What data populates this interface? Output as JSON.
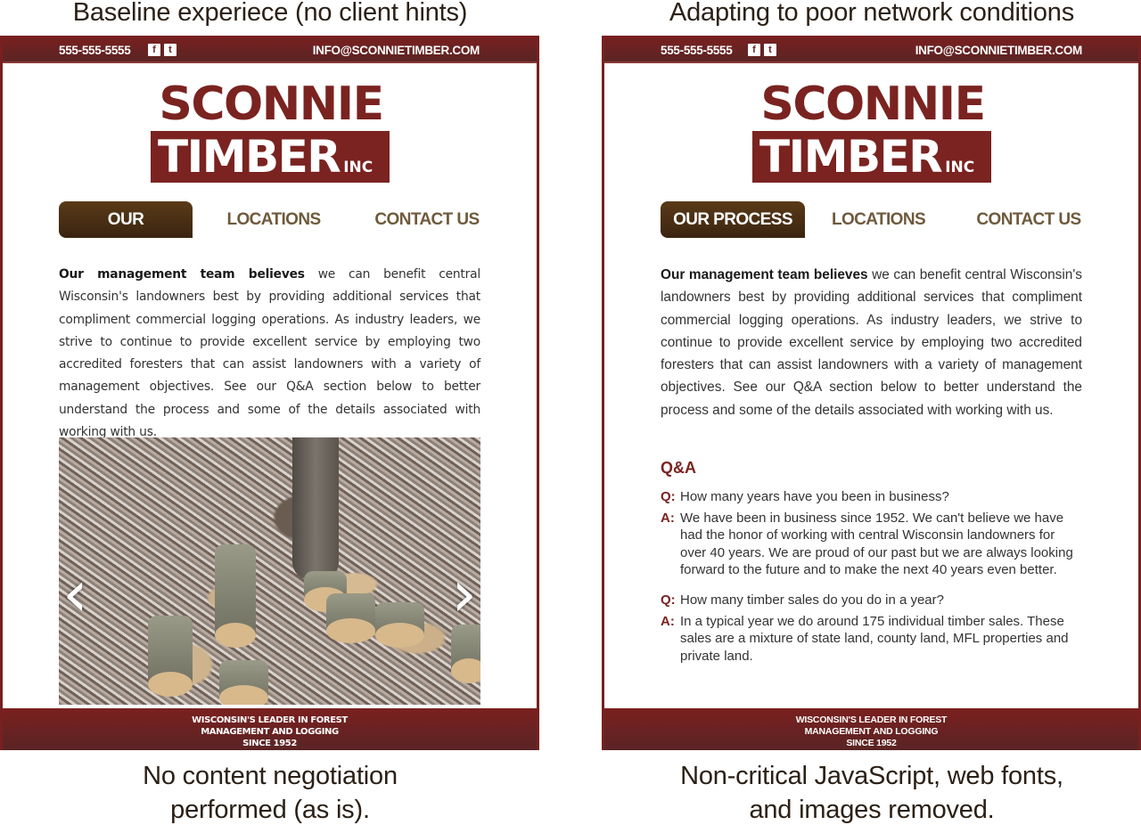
{
  "captions": {
    "left_top": "Baseline experiece (no client hints)",
    "right_top": "Adapting to poor network conditions",
    "left_bottom_line1": "No content negotiation",
    "left_bottom_line2": "performed (as is).",
    "right_bottom_line1": "Non-critical JavaScript, web fonts,",
    "right_bottom_line2": "and images removed."
  },
  "site": {
    "phone": "555-555-5555",
    "social": [
      {
        "icon": "facebook-icon",
        "glyph": "f"
      },
      {
        "icon": "twitter-icon",
        "glyph": "t"
      }
    ],
    "email": "INFO@SCONNIETIMBER.COM",
    "logo": {
      "line1": "SCONNIE",
      "line2": "TIMBER",
      "suffix": "INC"
    },
    "nav": [
      {
        "label": "OUR PROCESS",
        "active": true
      },
      {
        "label": "LOCATIONS",
        "active": false
      },
      {
        "label": "CONTACT US",
        "active": false
      }
    ],
    "intro": {
      "bold": "Our management team believes",
      "text": " we can benefit central Wisconsin's landowners best by providing additional services that compliment commercial logging operations. As industry leaders, we strive to continue to provide excellent service by employing two accredited foresters that can assist landowners with a variety of management objectives. See our Q&A section below to better understand the process and some of the details associated with working with us."
    },
    "carousel": {
      "prev_glyph": "‹",
      "next_glyph": "›"
    },
    "qa": {
      "heading": "Q&A",
      "q_tag": "Q:",
      "a_tag": "A:",
      "items": [
        {
          "q": "How many years have you been in business?",
          "a": "We have been in business since 1952. We can't believe we have had the honor of working with central Wisconsin landowners for over 40 years. We are proud of our past but we are always looking forward to the future and to make the next 40 years even better."
        },
        {
          "q": "How many timber sales do you do in a year?",
          "a": "In a typical year we do around 175 individual timber sales. These sales are a mixture of state land, county land, MFL properties and private land."
        }
      ]
    },
    "footer": {
      "line1": "WISCONSIN'S LEADER IN FOREST",
      "line2": "MANAGEMENT AND LOGGING",
      "line3": "SINCE 1952"
    }
  },
  "colors": {
    "brand_red": "#7a2320",
    "nav_active_brown": "#4a2e14",
    "nav_text_brown": "#6f5a3c"
  }
}
